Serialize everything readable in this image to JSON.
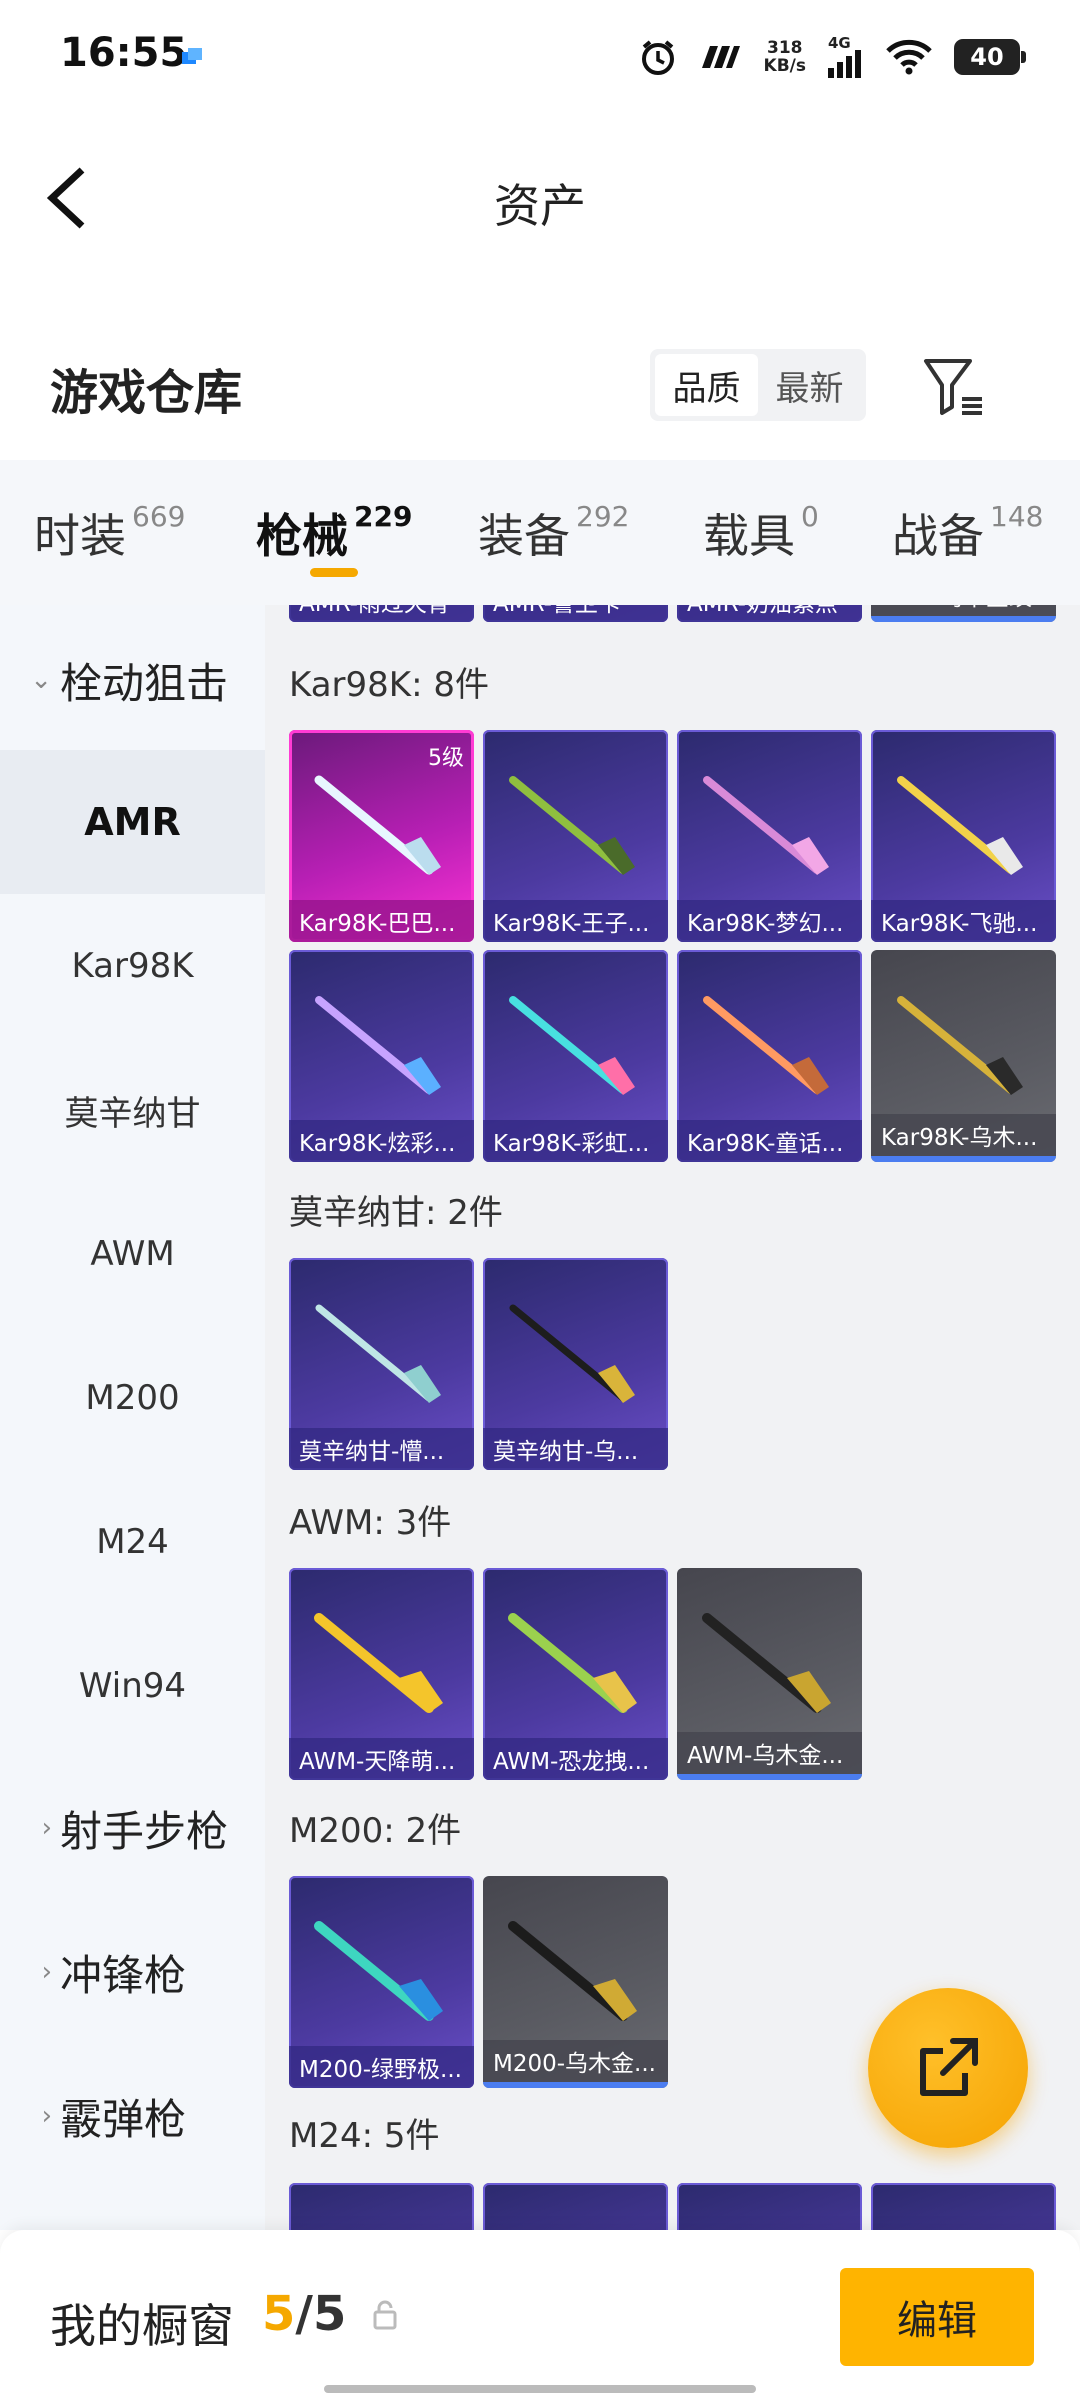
{
  "status_bar": {
    "time": "16:55",
    "speed_value": "318",
    "speed_unit": "KB/s",
    "network": "4G",
    "battery": "40"
  },
  "header": {
    "title": "资产"
  },
  "section": {
    "title": "游戏仓库",
    "sort_options": [
      "品质",
      "最新"
    ],
    "sort_selected": "品质"
  },
  "tabs": [
    {
      "label": "时装",
      "count": "669"
    },
    {
      "label": "枪械",
      "count": "229"
    },
    {
      "label": "装备",
      "count": "292"
    },
    {
      "label": "载具",
      "count": "0"
    },
    {
      "label": "战备",
      "count": "148"
    }
  ],
  "sidebar": {
    "group_main": "栓动狙击",
    "items": [
      "AMR",
      "Kar98K",
      "莫辛纳甘",
      "AWM",
      "M200",
      "M24",
      "Win94"
    ],
    "active_item": "AMR",
    "groups_collapsed": [
      "射手步枪",
      "冲锋枪",
      "霰弹枪"
    ]
  },
  "content": {
    "top_partial_cards": [
      "AMR-雨过天青",
      "AMR-警卫卡",
      "AMR-奶油紫点",
      "AMR-乌木金纹"
    ],
    "categories": [
      {
        "label": "Kar98K: 8件",
        "cards": [
          {
            "name": "Kar98K-巴巴...",
            "level": "5级"
          },
          {
            "name": "Kar98K-王子..."
          },
          {
            "name": "Kar98K-梦幻..."
          },
          {
            "name": "Kar98K-飞驰..."
          },
          {
            "name": "Kar98K-炫彩..."
          },
          {
            "name": "Kar98K-彩虹..."
          },
          {
            "name": "Kar98K-童话..."
          },
          {
            "name": "Kar98K-乌木..."
          }
        ]
      },
      {
        "label": "莫辛纳甘: 2件",
        "cards": [
          {
            "name": "莫辛纳甘-懵..."
          },
          {
            "name": "莫辛纳甘-乌..."
          }
        ]
      },
      {
        "label": "AWM: 3件",
        "cards": [
          {
            "name": "AWM-天降萌..."
          },
          {
            "name": "AWM-恐龙拽..."
          },
          {
            "name": "AWM-乌木金..."
          }
        ]
      },
      {
        "label": "M200: 2件",
        "cards": [
          {
            "name": "M200-绿野极..."
          },
          {
            "name": "M200-乌木金..."
          }
        ]
      },
      {
        "label": "M24: 5件"
      }
    ]
  },
  "bottom_bar": {
    "label": "我的橱窗",
    "current": "5",
    "separator": "/",
    "total": "5",
    "edit_label": "编辑"
  },
  "colors": {
    "accent": "#f5a800",
    "card_purple": "#4c3aa0",
    "card_pink": "#d62fc8",
    "card_gray": "#5a5b62"
  }
}
